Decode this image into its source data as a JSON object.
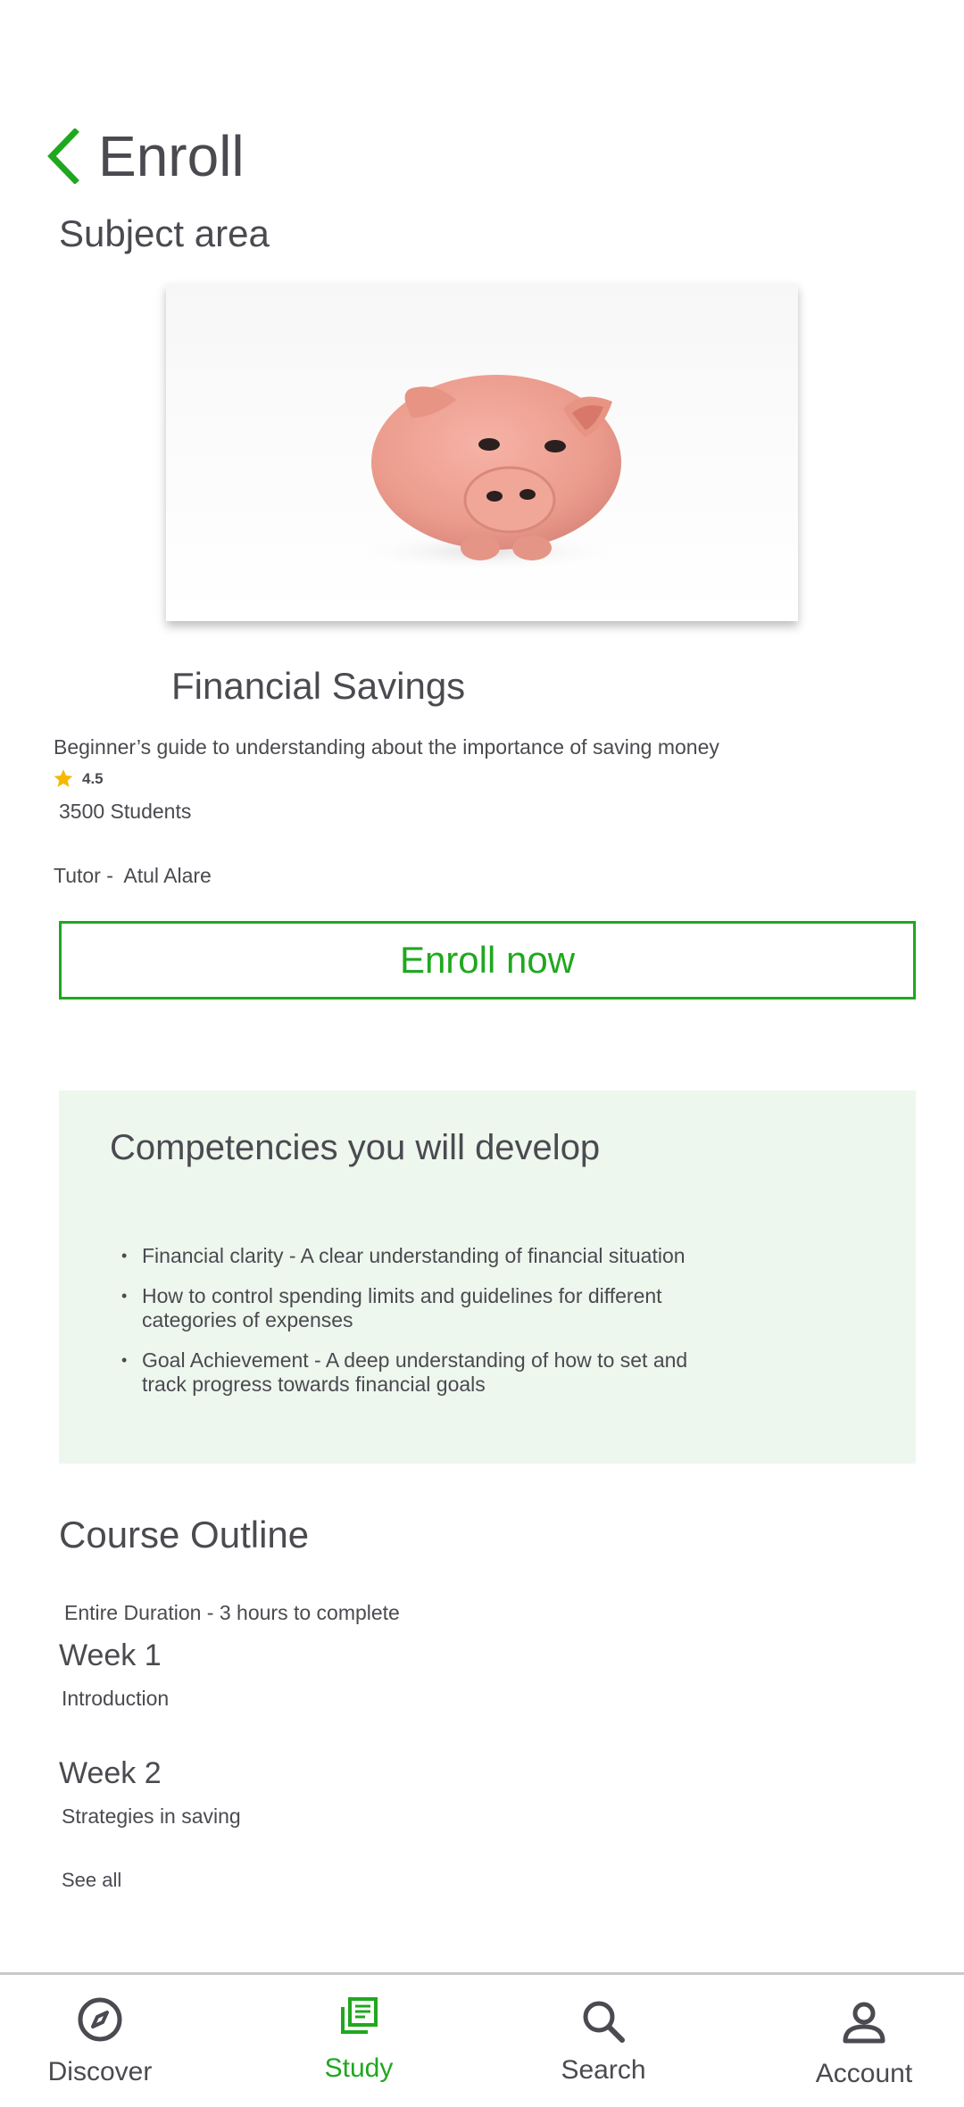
{
  "header": {
    "title": "Enroll"
  },
  "section": {
    "subject_area": "Subject area"
  },
  "course": {
    "title": "Financial Savings",
    "description": "Beginner’s guide to  understanding  about the importance of saving money",
    "rating": "4.5",
    "students": "3500 Students",
    "tutor": "Tutor -  Atul Alare"
  },
  "enroll_button": {
    "label": "Enroll now"
  },
  "competencies": {
    "title": "Competencies you will develop",
    "items": [
      "Financial clarity - A  clear understanding of financial situation",
      "How to control spending limits and guidelines for different categories of expenses",
      "Goal Achievement -  A deep understanding of how to set and track progress towards financial goals"
    ]
  },
  "outline": {
    "title": "Course Outline",
    "duration": "Entire Duration - 3 hours to complete",
    "weeks": [
      {
        "title": "Week 1",
        "subtitle": "Introduction"
      },
      {
        "title": "Week 2",
        "subtitle": "Strategies in saving"
      }
    ],
    "see_all": "See all"
  },
  "bottom_nav": {
    "items": [
      {
        "label": "Discover",
        "icon": "compass-icon"
      },
      {
        "label": "Study",
        "icon": "study-icon",
        "active": true
      },
      {
        "label": "Search",
        "icon": "search-icon"
      },
      {
        "label": "Account",
        "icon": "account-icon"
      }
    ]
  },
  "colors": {
    "accent": "#1fa81f",
    "text": "#4a4a50",
    "competencies_bg": "#eef7ee",
    "star": "#f5b900"
  }
}
